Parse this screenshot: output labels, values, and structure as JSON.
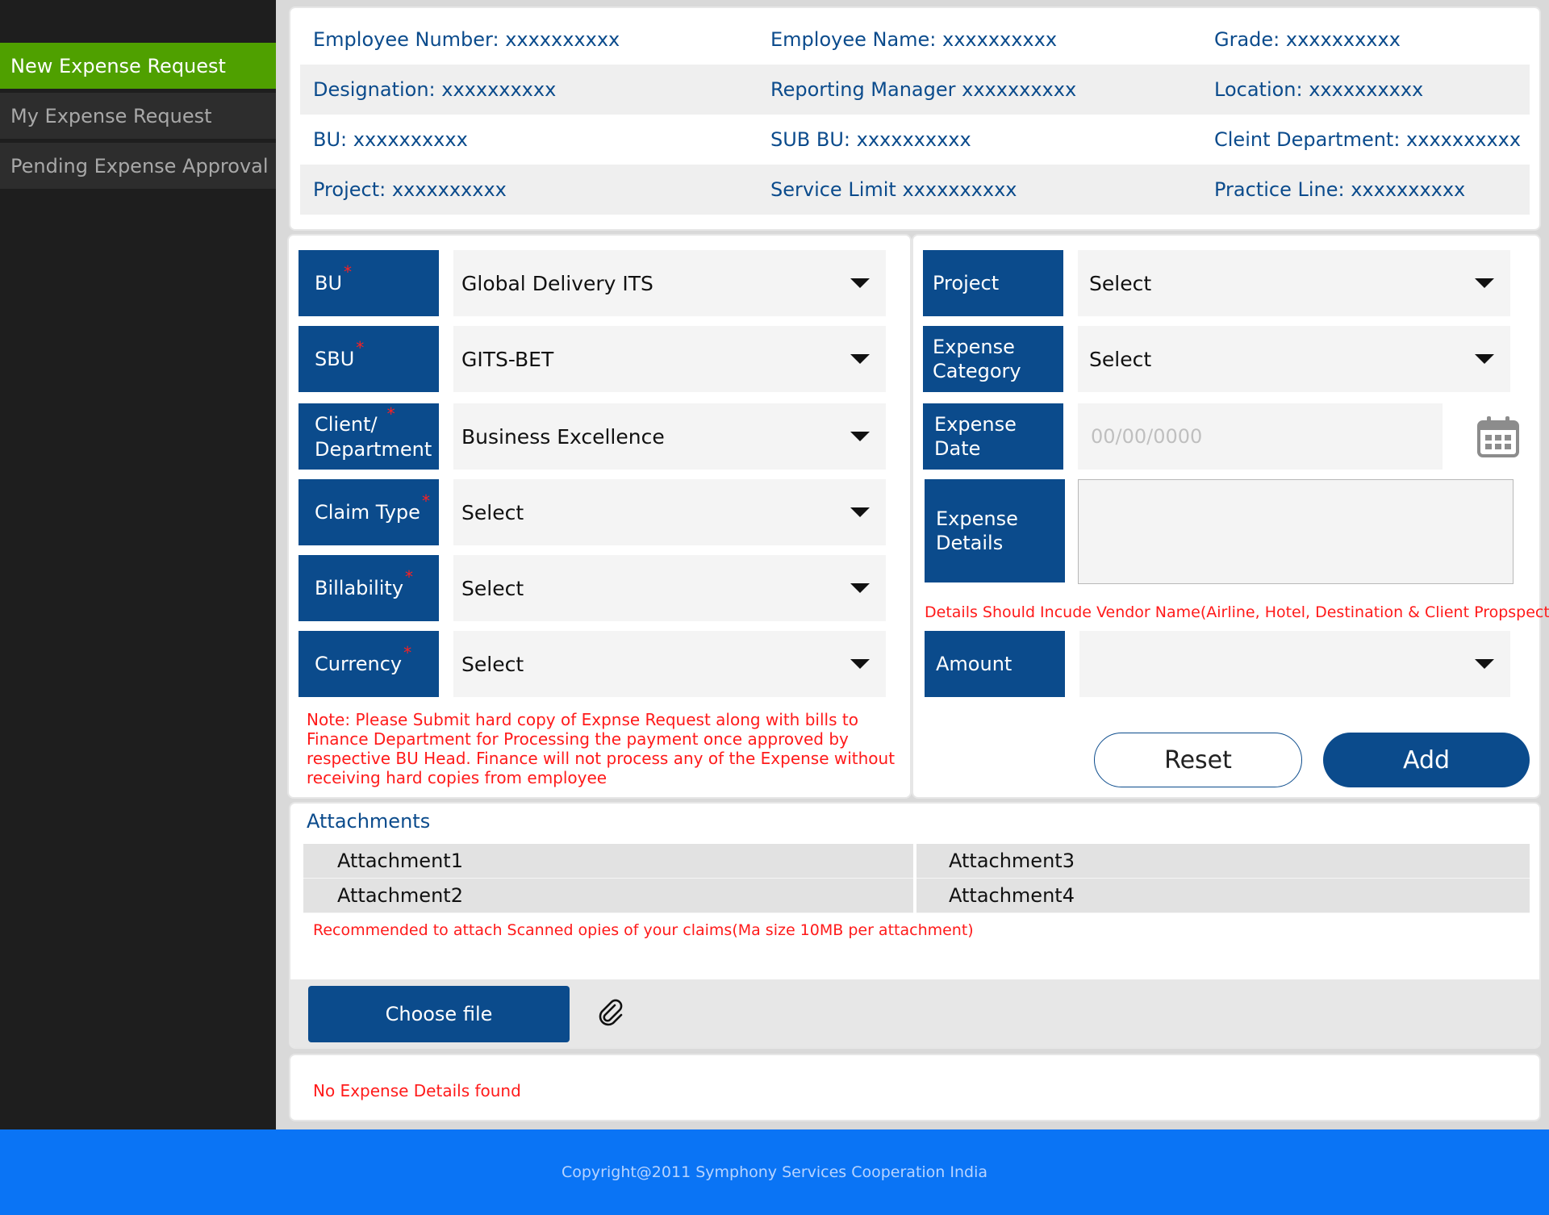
{
  "sidebar": {
    "items": [
      {
        "label": "New Expense Request"
      },
      {
        "label": "My Expense Request"
      },
      {
        "label": "Pending Expense Approval"
      }
    ]
  },
  "employee": {
    "employee_number": "Employee Number: xxxxxxxxxx",
    "employee_name": "Employee Name: xxxxxxxxxx",
    "grade": "Grade: xxxxxxxxxx",
    "designation": "Designation: xxxxxxxxxx",
    "reporting_manager": "Reporting Manager xxxxxxxxxx",
    "location": "Location: xxxxxxxxxx",
    "bu": "BU: xxxxxxxxxx",
    "sub_bu": "SUB BU: xxxxxxxxxx",
    "client_department": "Cleint Department: xxxxxxxxxx",
    "project": "Project: xxxxxxxxxx",
    "service_limit": "Service Limit xxxxxxxxxx",
    "practice_line": "Practice Line: xxxxxxxxxx"
  },
  "form_left": {
    "bu": {
      "label": "BU",
      "value": "Global Delivery ITS"
    },
    "sbu": {
      "label": "SBU",
      "value": "GITS-BET"
    },
    "client": {
      "label_line1": "Client/",
      "label_line2": "Department",
      "value": "Business Excellence"
    },
    "claim_type": {
      "label": "Claim Type",
      "value": "Select"
    },
    "billability": {
      "label": "Billability",
      "value": "Select"
    },
    "currency": {
      "label": "Currency",
      "value": "Select"
    },
    "required_mark": "*",
    "note": "Note: Please Submit hard copy of Expnse Request along with bills to Finance Department for Processing the payment once approved by respective BU Head. Finance will not process any of the Expense without receiving hard copies from employee"
  },
  "form_right": {
    "project": {
      "label": "Project",
      "value": "Select"
    },
    "expense_category": {
      "label_line1": "Expense",
      "label_line2": "Category",
      "value": "Select"
    },
    "expense_date": {
      "label": "Expense Date",
      "placeholder": "00/00/0000"
    },
    "expense_details": {
      "label_line1": "Expense",
      "label_line2": "Details",
      "value": ""
    },
    "details_hint": "Details Should Incude Vendor Name(Airline, Hotel, Destination & Client Propspectus)",
    "amount": {
      "label": "Amount",
      "value": ""
    },
    "reset_label": "Reset",
    "add_label": "Add"
  },
  "attachments": {
    "title": "Attachments",
    "items": [
      "Attachment1",
      "Attachment3",
      "Attachment2",
      "Attachment4"
    ],
    "hint": "Recommended to attach Scanned opies of your claims(Ma size 10MB per attachment)",
    "choose_label": "Choose file"
  },
  "results": {
    "message": "No Expense Details found"
  },
  "footer": {
    "copyright": "Copyright@2011 Symphony Services Cooperation India"
  },
  "colors": {
    "primary": "#0b4b8c",
    "active_nav": "#4fa000",
    "warning_text": "#ff1a1a",
    "footer": "#0a74f5",
    "sidebar": "#1e1e1e"
  },
  "icons": {
    "calendar": "calendar-icon",
    "attach": "paperclip-icon",
    "dropdown": "caret-down-icon"
  }
}
